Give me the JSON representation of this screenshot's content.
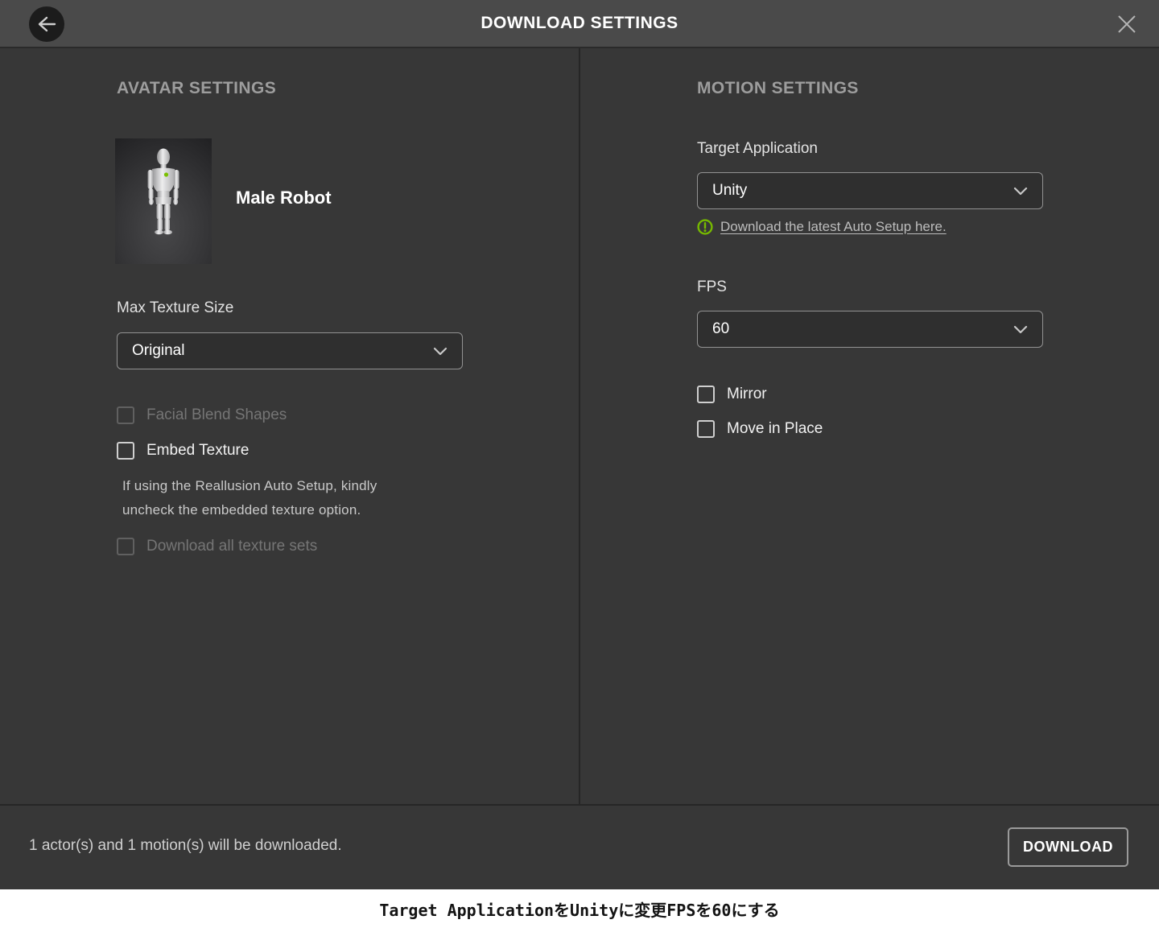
{
  "titlebar": {
    "title": "DOWNLOAD SETTINGS",
    "back_icon": "arrow-left-icon",
    "close_icon": "close-icon"
  },
  "avatar": {
    "section_title": "AVATAR SETTINGS",
    "name": "Male Robot",
    "thumbnail": "male-robot-3d-mannequin",
    "max_texture": {
      "label": "Max Texture Size",
      "value": "Original"
    },
    "facial_blend_shapes": {
      "label": "Facial Blend Shapes",
      "checked": false,
      "enabled": false
    },
    "embed_texture": {
      "label": "Embed Texture",
      "checked": false,
      "enabled": true
    },
    "note_line1": "If using the Reallusion Auto Setup, kindly",
    "note_line2": "uncheck the embedded texture option.",
    "download_all_texture_sets": {
      "label": "Download all texture sets",
      "checked": false,
      "enabled": false
    }
  },
  "motion": {
    "section_title": "MOTION SETTINGS",
    "target_application": {
      "label": "Target Application",
      "value": "Unity"
    },
    "auto_setup_link": "Download the latest Auto Setup here.",
    "fps": {
      "label": "FPS",
      "value": "60"
    },
    "mirror": {
      "label": "Mirror",
      "checked": false,
      "enabled": true
    },
    "move_in_place": {
      "label": "Move in Place",
      "checked": false,
      "enabled": true
    }
  },
  "footer": {
    "summary": "1 actor(s) and 1 motion(s) will be downloaded.",
    "download_button": "DOWNLOAD"
  },
  "caption": "Target ApplicationをUnityに変更FPSを60にする",
  "colors": {
    "titlebar_bg": "#4a4a4a",
    "panel_bg": "#373737",
    "divider": "#262626",
    "accent_green": "#76b900",
    "caption_bg": "#ffffff"
  }
}
